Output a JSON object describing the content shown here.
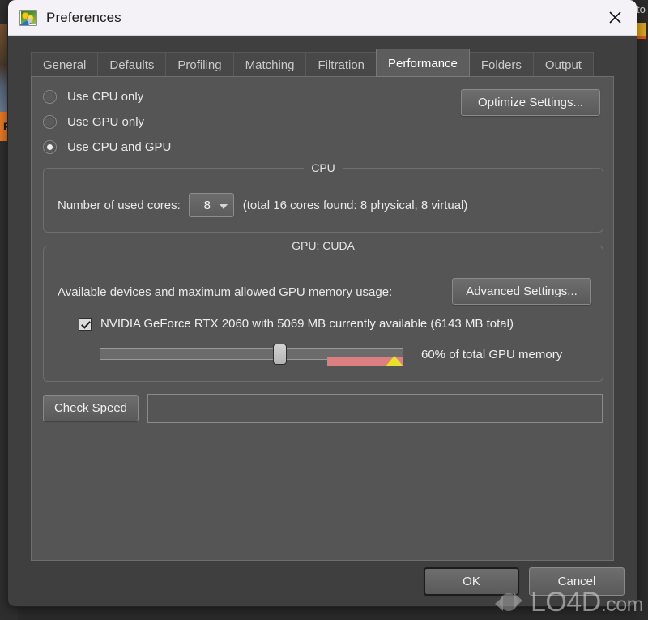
{
  "background": {
    "left_tab_text": "Fr",
    "right_tab_text": "to"
  },
  "window": {
    "title": "Preferences",
    "icon": "image-edit-icon",
    "close_label": "✕"
  },
  "tabs": [
    {
      "label": "General",
      "active": false
    },
    {
      "label": "Defaults",
      "active": false
    },
    {
      "label": "Profiling",
      "active": false
    },
    {
      "label": "Matching",
      "active": false
    },
    {
      "label": "Filtration",
      "active": false
    },
    {
      "label": "Performance",
      "active": true
    },
    {
      "label": "Folders",
      "active": false
    },
    {
      "label": "Output",
      "active": false
    }
  ],
  "performance": {
    "processing_mode": {
      "options": [
        {
          "label": "Use CPU only",
          "selected": false
        },
        {
          "label": "Use GPU only",
          "selected": false
        },
        {
          "label": "Use CPU and GPU",
          "selected": true
        }
      ]
    },
    "optimize_button": "Optimize Settings...",
    "cpu": {
      "group_title": "CPU",
      "cores_label": "Number of used cores:",
      "cores_value": "8",
      "cores_note": "(total 16 cores found: 8 physical, 8 virtual)"
    },
    "gpu": {
      "group_title": "GPU: CUDA",
      "devices_label": "Available devices and maximum allowed GPU memory usage:",
      "advanced_button": "Advanced Settings...",
      "device": {
        "checked": true,
        "label": "NVIDIA GeForce RTX 2060 with 5069 MB currently available (6143 MB total)"
      },
      "memory_slider": {
        "percent": 60,
        "percent_label": "60%  of total GPU memory",
        "warning_start_percent": 75,
        "warning_color": "#dd7f80",
        "warning_marker_color": "#e8e02a"
      }
    },
    "check_speed_button": "Check Speed",
    "speed_field_value": "",
    "speed_field_placeholder": ""
  },
  "footer": {
    "ok_label": "OK",
    "cancel_label": "Cancel"
  },
  "watermark": {
    "text_main": "LO4D",
    "text_suffix": ".com"
  }
}
